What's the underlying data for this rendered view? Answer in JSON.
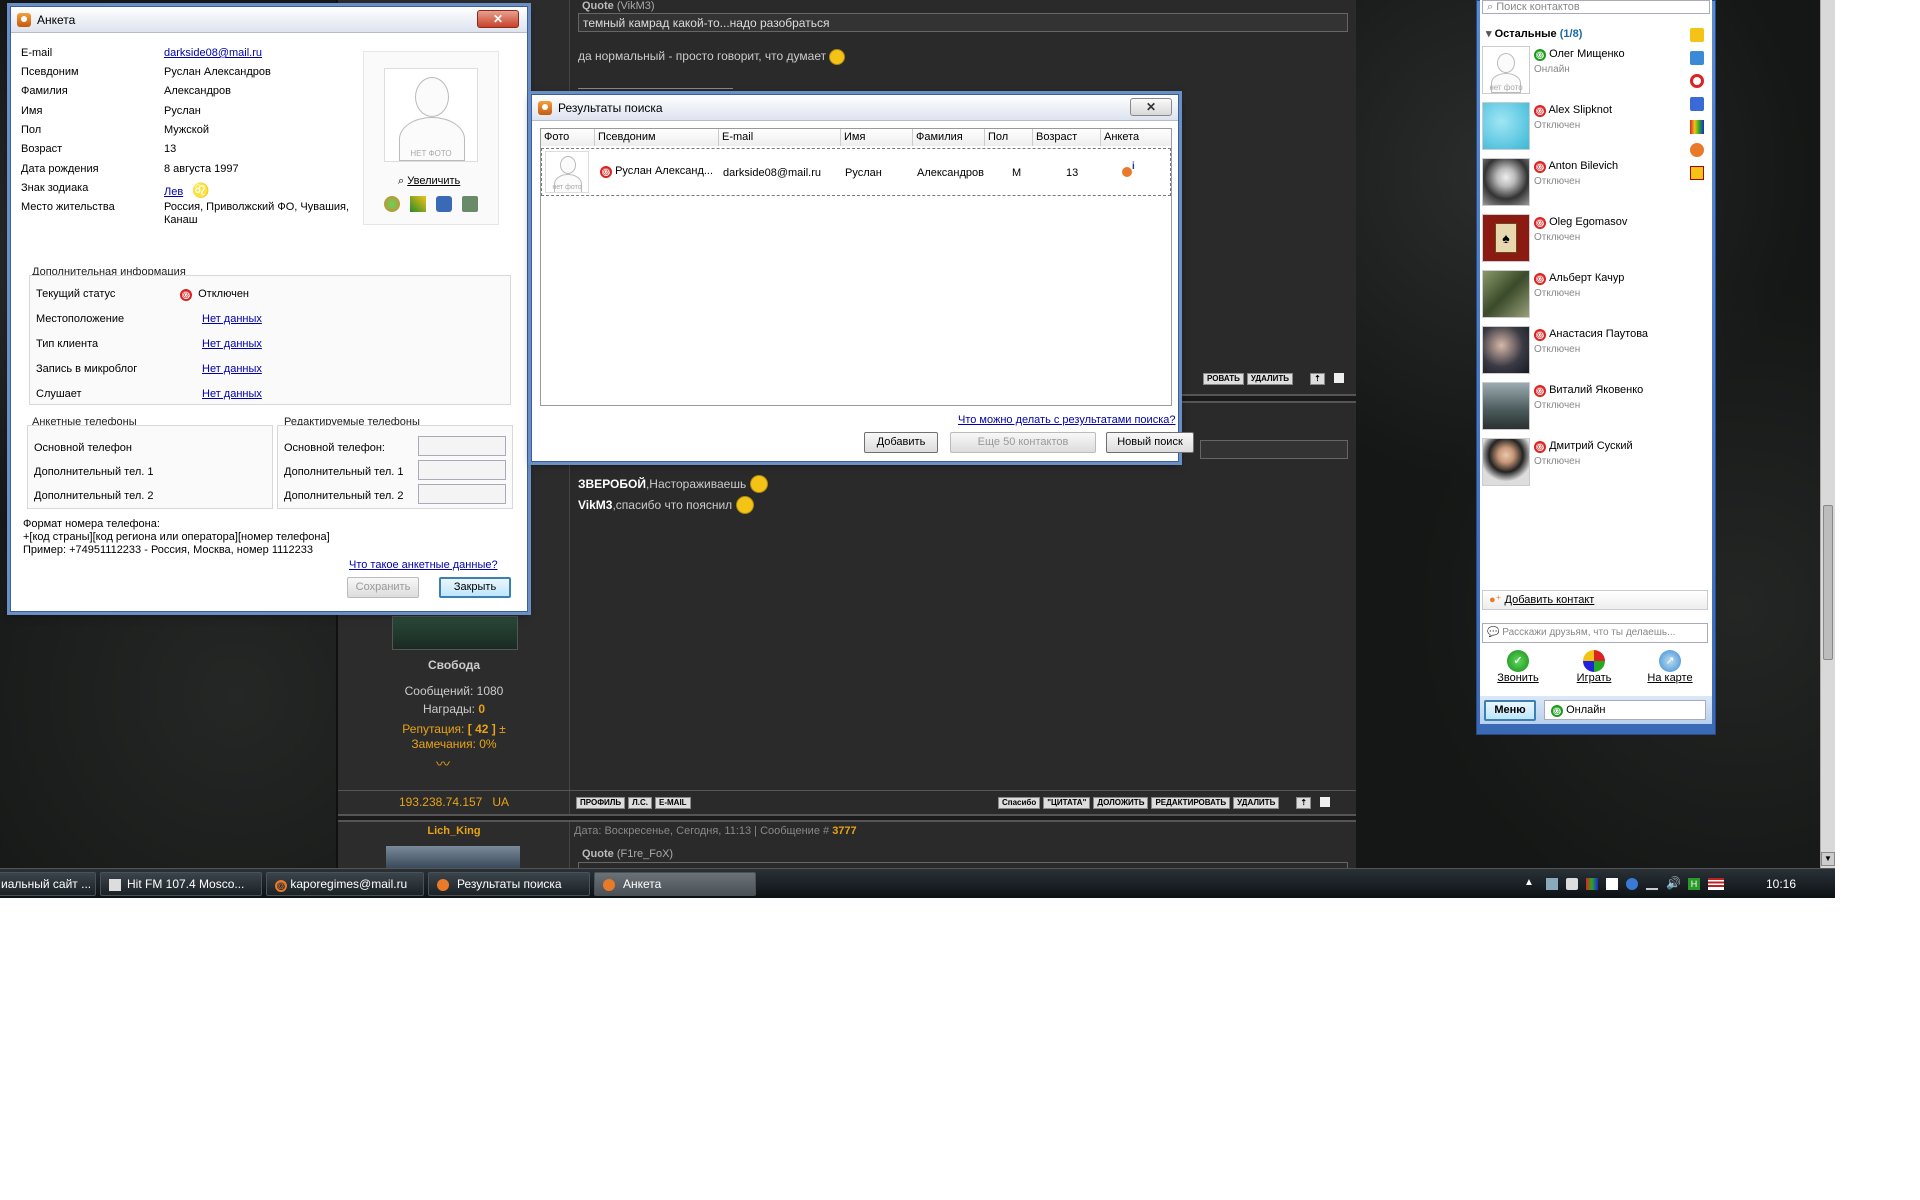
{
  "anketa": {
    "title": "Анкета",
    "fields": [
      {
        "label": "E-mail",
        "value": "darkside08@mail.ru",
        "link": true
      },
      {
        "label": "Псевдоним",
        "value": "Руслан Александров"
      },
      {
        "label": "Фамилия",
        "value": "Александров"
      },
      {
        "label": "Имя",
        "value": "Руслан"
      },
      {
        "label": "Пол",
        "value": "Мужской"
      },
      {
        "label": "Возраст",
        "value": "13"
      },
      {
        "label": "Дата рождения",
        "value": "8 августа 1997"
      },
      {
        "label": "Знак зодиака",
        "value": "Лев",
        "link": true
      },
      {
        "label": "Место жительства",
        "value": "Россия, Приволжский ФО, Чувашия, Канаш"
      }
    ],
    "photo_caption": "НЕТ ФОТО",
    "enlarge": "Увеличить",
    "extra_title": "Дополнительная информация",
    "extra": [
      {
        "label": "Текущий статус",
        "value": "Отключен"
      },
      {
        "label": "Местоположение",
        "value": "Нет данных"
      },
      {
        "label": "Тип клиента",
        "value": "Нет данных"
      },
      {
        "label": "Запись в микроблог",
        "value": "Нет данных"
      },
      {
        "label": "Слушает",
        "value": "Нет данных"
      }
    ],
    "phones_title": "Анкетные телефоны",
    "phones": [
      "Основной телефон",
      "Дополнительный тел. 1",
      "Дополнительный тел. 2"
    ],
    "edit_phones_title": "Редактируемые телефоны",
    "edit_phones": [
      "Основной телефон:",
      "Дополнительный тел. 1",
      "Дополнительный тел. 2"
    ],
    "format_lines": [
      "Формат номера телефона:",
      "+[код страны][код региона или оператора][номер телефона]",
      "Пример: +74951112233 - Россия, Москва, номер 1112233"
    ],
    "what_link": "Что такое анкетные данные?",
    "save": "Сохранить",
    "close": "Закрыть"
  },
  "search": {
    "title": "Результаты поиска",
    "columns": [
      "Фото",
      "Псевдоним",
      "E-mail",
      "Имя",
      "Фамилия",
      "Пол",
      "Возраст",
      "Анкета"
    ],
    "row": {
      "photo": "нет фото",
      "nick": "Руслан Александ...",
      "email": "darkside08@mail.ru",
      "name": "Руслан",
      "surname": "Александров",
      "sex": "М",
      "age": "13"
    },
    "help_link": "Что можно делать с результатами поиска?",
    "add": "Добавить",
    "more": "Еще 50 контактов",
    "new_search": "Новый поиск"
  },
  "forum": {
    "quote_top": "Quote",
    "quote_top_author": "(VikM3)",
    "quote_top_text": "темный камрад какой-то...надо разобраться",
    "reply_text": "да нормальный - просто говорит, что думает",
    "line1_bold": "ЗВЕРОБОЙ",
    "line1_rest": ",Настораживаешь",
    "line2_bold": "VikM3",
    "line2_rest": ",спасибо что пояснил",
    "user_rank": "Свобода",
    "messages": "Сообщений: 1080",
    "awards_label": "Награды:",
    "awards_value": "0",
    "rep_label": "Репутация:",
    "rep_value": "[ 42 ]",
    "rep_pm": "±",
    "warnings": "Замечания: 0%",
    "ip": "193.238.74.157",
    "country": "UA",
    "bottom_buttons": [
      "ПРОФИЛЬ",
      "Л.С.",
      "E-MAIL"
    ],
    "right_buttons": [
      "Спасибо",
      "\"ЦИТАТА\"",
      "ДОЛОЖИТЬ",
      "РЕДАКТИРОВАТЬ",
      "УДАЛИТЬ"
    ],
    "top_buttons": [
      "РОВАТЬ",
      "УДАЛИТЬ"
    ],
    "next_user": "Lich_King",
    "next_date_label": "Дата: Воскресенье, Сегодня, 11:13 | Сообщение #",
    "next_msg_num": "3777",
    "next_quote": "Quote",
    "next_quote_author": "(F1re_FoX)"
  },
  "contacts": {
    "search_placeholder": "Поиск контактов",
    "group": "Остальные",
    "group_count": "(1/8)",
    "list": [
      {
        "name": "Олег Мищенко",
        "status": "Онлайн",
        "online": true,
        "photo": "нет фото"
      },
      {
        "name": "Alex Slipknot",
        "status": "Отключен",
        "color": "#3bb7d6"
      },
      {
        "name": "Anton Bilevich",
        "status": "Отключен",
        "color": "#6a6a6a"
      },
      {
        "name": "Oleg Egomasov",
        "status": "Отключен",
        "color": "#8a1a12"
      },
      {
        "name": "Альберт Качур",
        "status": "Отключен",
        "color": "#5a6a3a"
      },
      {
        "name": "Анастасия Паутова",
        "status": "Отключен",
        "color": "#3a3a44"
      },
      {
        "name": "Виталий Яковенко",
        "status": "Отключен",
        "color": "#4a5a5a"
      },
      {
        "name": "Дмитрий Суский",
        "status": "Отключен",
        "color": "#7a5a4a"
      }
    ],
    "add_contact": "Добавить контакт",
    "microblog_placeholder": "Расскажи друзьям, что ты делаешь...",
    "actions": [
      "Звонить",
      "Играть",
      "На карте"
    ],
    "menu": "Меню",
    "status": "Онлайн"
  },
  "taskbar": {
    "items": [
      {
        "label": "иальный сайт ...",
        "icon": "browser-icon"
      },
      {
        "label": "Hit FM 107.4 Mosco...",
        "icon": "radio-icon"
      },
      {
        "label": "kaporegimes@mail.ru",
        "icon": "mail-agent-icon"
      },
      {
        "label": "Результаты поиска",
        "icon": "mail-agent-icon"
      },
      {
        "label": "Анкета",
        "icon": "mail-agent-icon",
        "active": true
      }
    ],
    "clock": "10:16"
  }
}
